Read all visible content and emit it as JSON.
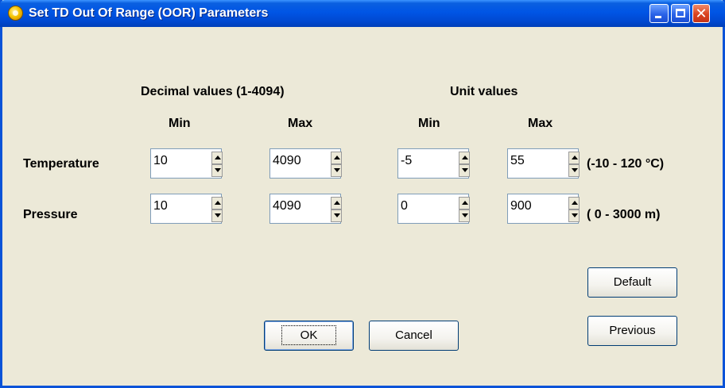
{
  "window": {
    "title": "Set TD Out Of Range (OOR) Parameters"
  },
  "headers": {
    "decimal": "Decimal values (1-4094)",
    "unit": "Unit values",
    "min": "Min",
    "max": "Max"
  },
  "rows": {
    "temperature": {
      "label": "Temperature",
      "dec_min": "10",
      "dec_max": "4090",
      "unit_min": "-5",
      "unit_max": "55",
      "range": "(-10  -  120 °C)"
    },
    "pressure": {
      "label": "Pressure",
      "dec_min": "10",
      "dec_max": "4090",
      "unit_min": "0",
      "unit_max": "900",
      "range": "( 0  -  3000 m)"
    }
  },
  "buttons": {
    "default": "Default",
    "previous": "Previous",
    "ok": "OK",
    "cancel": "Cancel"
  },
  "icons": {
    "app": "sun-icon",
    "spin_up": "arrow-up-icon",
    "spin_down": "arrow-down-icon"
  }
}
